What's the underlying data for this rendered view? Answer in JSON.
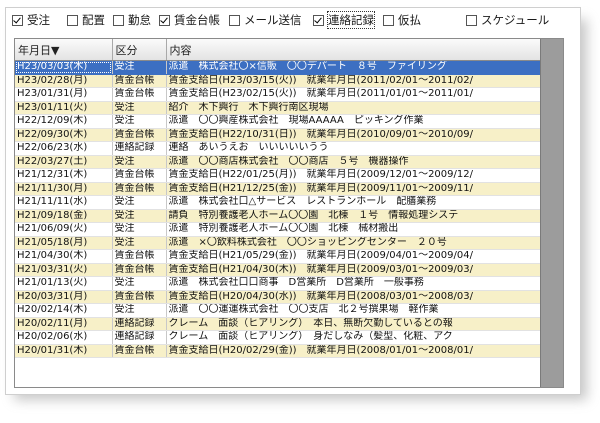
{
  "filters": [
    {
      "label": "受注",
      "checked": true
    },
    {
      "label": "配置",
      "checked": false
    },
    {
      "label": "勤怠",
      "checked": false
    },
    {
      "label": "賃金台帳",
      "checked": true
    },
    {
      "label": "メール送信",
      "checked": false
    },
    {
      "label": "連絡記録",
      "checked": true
    },
    {
      "label": "仮払",
      "checked": false
    },
    {
      "label": "スケジュール",
      "checked": false
    }
  ],
  "table": {
    "headers": [
      "年月日▼",
      "区分",
      "内容"
    ],
    "selected_row": 0,
    "rows": [
      {
        "date": "H23/03/03(木)",
        "kubun": "受注",
        "content": "派遣　株式会社〇×信販　〇〇デパート　８号　ファイリング"
      },
      {
        "date": "H23/02/28(月)",
        "kubun": "賃金台帳",
        "content": "賃金支給日(H23/03/15(火))　就業年月日(2011/02/01～2011/02/"
      },
      {
        "date": "H23/01/31(月)",
        "kubun": "賃金台帳",
        "content": "賃金支給日(H23/02/15(火))　就業年月日(2011/01/01～2011/01/"
      },
      {
        "date": "H23/01/11(火)",
        "kubun": "受注",
        "content": "紹介　木下興行　木下興行南区現場"
      },
      {
        "date": "H22/12/09(木)",
        "kubun": "受注",
        "content": "派遣　〇〇興産株式会社　現場AAAAA　ピッキング作業"
      },
      {
        "date": "H22/09/30(木)",
        "kubun": "賃金台帳",
        "content": "賃金支給日(H22/10/31(日))　就業年月日(2010/09/01～2010/09/"
      },
      {
        "date": "H22/06/23(水)",
        "kubun": "連絡記録",
        "content": "連絡　あいうえお　いいいいいうう"
      },
      {
        "date": "H22/03/27(土)",
        "kubun": "受注",
        "content": "派遣　〇〇商店株式会社　〇〇商店　５号　機器操作"
      },
      {
        "date": "H21/12/31(木)",
        "kubun": "賃金台帳",
        "content": "賃金支給日(H22/01/25(月))　就業年月日(2009/12/01～2009/12/"
      },
      {
        "date": "H21/11/30(月)",
        "kubun": "賃金台帳",
        "content": "賃金支給日(H21/12/25(金))　就業年月日(2009/11/01～2009/11/"
      },
      {
        "date": "H21/11/11(水)",
        "kubun": "受注",
        "content": "派遣　株式会社口△サービス　レストランホール　配膳業務"
      },
      {
        "date": "H21/09/18(金)",
        "kubun": "受注",
        "content": "請負　特別養護老人ホーム〇〇園　北棟　１号　情報処理システ"
      },
      {
        "date": "H21/06/09(火)",
        "kubun": "受注",
        "content": "派遣　特別養護老人ホーム〇〇園　北棟　械材搬出"
      },
      {
        "date": "H21/05/18(月)",
        "kubun": "受注",
        "content": "派遣　×〇飲料株式会社　〇〇ショッピングセンター　２０号"
      },
      {
        "date": "H21/04/30(木)",
        "kubun": "賃金台帳",
        "content": "賃金支給日(H21/05/29(金))　就業年月日(2009/04/01～2009/04/"
      },
      {
        "date": "H21/03/31(火)",
        "kubun": "賃金台帳",
        "content": "賃金支給日(H21/04/30(木))　就業年月日(2009/03/01～2009/03/"
      },
      {
        "date": "H21/01/13(火)",
        "kubun": "受注",
        "content": "派遣　株式会社口口商事　D営業所　D営業所　一般事務"
      },
      {
        "date": "H20/03/31(月)",
        "kubun": "賃金台帳",
        "content": "賃金支給日(H20/04/30(水))　就業年月日(2008/03/01～2008/03/"
      },
      {
        "date": "H20/02/14(木)",
        "kubun": "受注",
        "content": "派遣　〇〇運運株式会社　〇〇支店　北２号撰果場　軽作業"
      },
      {
        "date": "H20/02/11(月)",
        "kubun": "連絡記録",
        "content": "クレーム　面談（ヒアリング）　本日、無断欠勤しているとの報"
      },
      {
        "date": "H20/02/06(水)",
        "kubun": "連絡記録",
        "content": "クレーム　面談（ヒアリング）　身だしなみ（髪型、化粧、アク"
      },
      {
        "date": "H20/01/31(木)",
        "kubun": "賃金台帳",
        "content": "賃金支給日(H20/02/29(金))　就業年月日(2008/01/01～2008/01/"
      }
    ]
  }
}
